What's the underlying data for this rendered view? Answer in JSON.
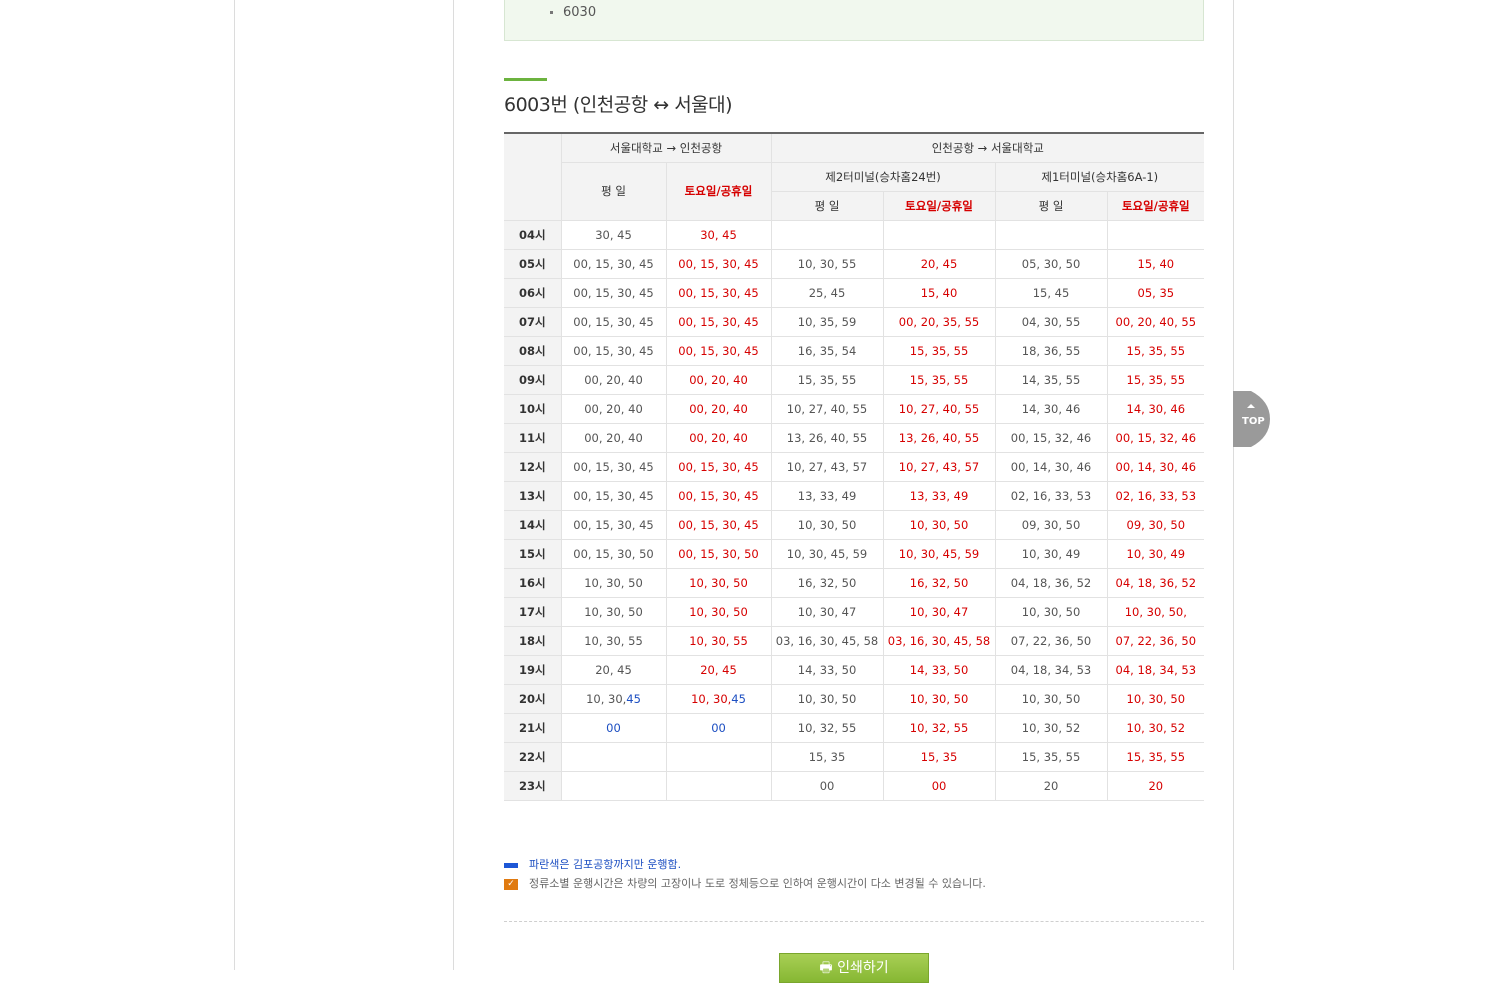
{
  "notice": {
    "item": "6030"
  },
  "route": {
    "title": "6003번 (인천공항 ↔ 서울대)"
  },
  "table": {
    "header_top": [
      "서울대학교 → 인천공항",
      "인천공항 → 서울대학교"
    ],
    "header_mid": [
      "제2터미널(승차홈24번)",
      "제1터미널(승차홈6A-1)"
    ],
    "weekday": "평 일",
    "holiday": "토요일/공휴일",
    "rows": [
      {
        "hour": "04시",
        "c": [
          "30, 45",
          "30, 45",
          "",
          "",
          "",
          ""
        ]
      },
      {
        "hour": "05시",
        "c": [
          "00, 15, 30, 45",
          "00, 15, 30, 45",
          "10, 30, 55",
          "20, 45",
          "05, 30, 50",
          "15, 40"
        ]
      },
      {
        "hour": "06시",
        "c": [
          "00, 15, 30, 45",
          "00, 15, 30, 45",
          "25, 45",
          "15, 40",
          "15, 45",
          "05, 35"
        ]
      },
      {
        "hour": "07시",
        "c": [
          "00, 15, 30, 45",
          "00, 15, 30, 45",
          "10, 35, 59",
          "00, 20, 35, 55",
          "04, 30, 55",
          "00, 20, 40, 55"
        ]
      },
      {
        "hour": "08시",
        "c": [
          "00, 15, 30, 45",
          "00, 15, 30, 45",
          "16, 35, 54",
          "15, 35, 55",
          "18, 36, 55",
          "15, 35, 55"
        ]
      },
      {
        "hour": "09시",
        "c": [
          "00, 20, 40",
          "00, 20, 40",
          "15, 35, 55",
          "15, 35, 55",
          "14, 35, 55",
          "15, 35, 55"
        ]
      },
      {
        "hour": "10시",
        "c": [
          "00, 20, 40",
          "00, 20, 40",
          "10, 27, 40, 55",
          "10, 27, 40, 55",
          "14, 30, 46",
          "14, 30, 46"
        ]
      },
      {
        "hour": "11시",
        "c": [
          "00, 20, 40",
          "00, 20, 40",
          "13, 26, 40, 55",
          "13, 26, 40, 55",
          "00, 15, 32, 46",
          "00, 15, 32, 46"
        ]
      },
      {
        "hour": "12시",
        "c": [
          "00, 15, 30, 45",
          "00, 15, 30, 45",
          "10, 27, 43, 57",
          "10, 27, 43, 57",
          "00, 14, 30, 46",
          "00, 14, 30, 46"
        ]
      },
      {
        "hour": "13시",
        "c": [
          "00, 15, 30, 45",
          "00, 15, 30, 45",
          "13, 33, 49",
          "13, 33, 49",
          "02, 16, 33, 53",
          "02, 16, 33, 53"
        ]
      },
      {
        "hour": "14시",
        "c": [
          "00, 15, 30, 45",
          "00, 15, 30, 45",
          "10, 30, 50",
          "10, 30, 50",
          "09, 30, 50",
          "09, 30, 50"
        ]
      },
      {
        "hour": "15시",
        "c": [
          "00, 15, 30, 50",
          "00, 15, 30, 50",
          "10, 30, 45, 59",
          "10, 30, 45, 59",
          "10, 30, 49",
          "10, 30, 49"
        ]
      },
      {
        "hour": "16시",
        "c": [
          "10, 30, 50",
          "10, 30, 50",
          "16, 32, 50",
          "16, 32, 50",
          "04, 18, 36, 52",
          "04, 18, 36, 52"
        ]
      },
      {
        "hour": "17시",
        "c": [
          "10, 30, 50",
          "10, 30, 50",
          "10, 30, 47",
          "10, 30, 47",
          "10, 30, 50",
          "10, 30, 50,"
        ]
      },
      {
        "hour": "18시",
        "c": [
          "10, 30, 55",
          "10, 30, 55",
          "03, 16, 30, 45, 58",
          "03, 16, 30, 45, 58",
          "07, 22, 36, 50",
          "07, 22, 36, 50"
        ]
      },
      {
        "hour": "19시",
        "c": [
          "20, 45",
          "20, 45",
          "14, 33, 50",
          "14, 33, 50",
          "04, 18, 34, 53",
          "04, 18, 34, 53"
        ]
      },
      {
        "hour": "20시",
        "c": [
          "10, 30,",
          "10, 30,",
          "10, 30, 50",
          "10, 30, 50",
          "10, 30, 50",
          "10, 30, 50"
        ],
        "blue": [
          "45",
          "45"
        ]
      },
      {
        "hour": "21시",
        "c": [
          "",
          "",
          "10, 32, 55",
          "10, 32, 55",
          "10, 30, 52",
          "10, 30, 52"
        ],
        "blue": [
          "00",
          "00"
        ]
      },
      {
        "hour": "22시",
        "c": [
          "",
          "",
          "15, 35",
          "15, 35",
          "15, 35, 55",
          "15, 35, 55"
        ]
      },
      {
        "hour": "23시",
        "c": [
          "",
          "",
          "00",
          "00",
          "20",
          "20"
        ]
      }
    ]
  },
  "legend": {
    "blue": "파란색은 김포공항까지만 운행함.",
    "orange": "정류소별 운행시간은 차량의 고장이나 도로 정체등으로 인하여 운행시간이 다소 변경될 수 있습니다."
  },
  "print_button": "인쇄하기",
  "top_button": "TOP",
  "colors": {
    "accent_green": "#6cb33f",
    "holiday_red": "#d60000",
    "gimpo_blue": "#1d4fc2"
  }
}
